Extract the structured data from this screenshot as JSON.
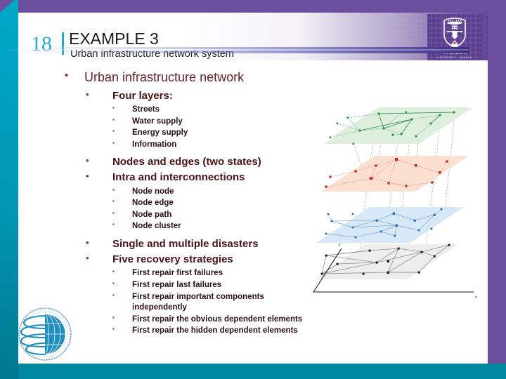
{
  "slide": {
    "number": "18",
    "title": "EXAMPLE 3",
    "subtitle": "Urban infrastructure network system",
    "accent_blue": "#29a8df",
    "band_purple": "#6b4f9e",
    "band_teal": "#00a0bd",
    "bullet_color": "#8b2b2f"
  },
  "logos": {
    "university_name": "Western",
    "university_tagline": "UNIVERSITY · CANADA",
    "emblem_name": "resilient-communities-globe-logo"
  },
  "content": {
    "heading": "Urban infrastructure network",
    "layers_heading": "Four layers:",
    "layers": [
      "Streets",
      "Water supply",
      "Energy supply",
      "Information"
    ],
    "nodes_edges": "Nodes and edges (two states)",
    "connections_heading": "Intra and interconnections",
    "connections": [
      "Node node",
      "Node edge",
      "Node path",
      "Node cluster"
    ],
    "disasters": "Single and multiple disasters",
    "strategies_heading": "Five recovery strategies",
    "strategies": [
      "First repair first failures",
      "First repair last failures",
      "First repair important components independently",
      "First repair the obvious dependent elements",
      "First repair the hidden  dependent elements"
    ]
  },
  "figure": {
    "name": "multilayer-network-diagram",
    "axis_x_label": "x",
    "axis_y_label": "y",
    "layers": [
      {
        "name": "information-layer",
        "fill": "#dff0df",
        "node_color": "#2d8a4e",
        "edge_color": "#4f9f6a"
      },
      {
        "name": "energy-layer",
        "fill": "#fbe0d2",
        "node_color": "#c22525",
        "edge_color": "#d56a5a"
      },
      {
        "name": "water-layer",
        "fill": "#d7e8f7",
        "node_color": "#1f5f9e",
        "edge_color": "#6f9dc4"
      },
      {
        "name": "streets-layer",
        "fill": "#ededed",
        "node_color": "#1a1a1a",
        "edge_color": "#8b8b8b"
      }
    ]
  }
}
